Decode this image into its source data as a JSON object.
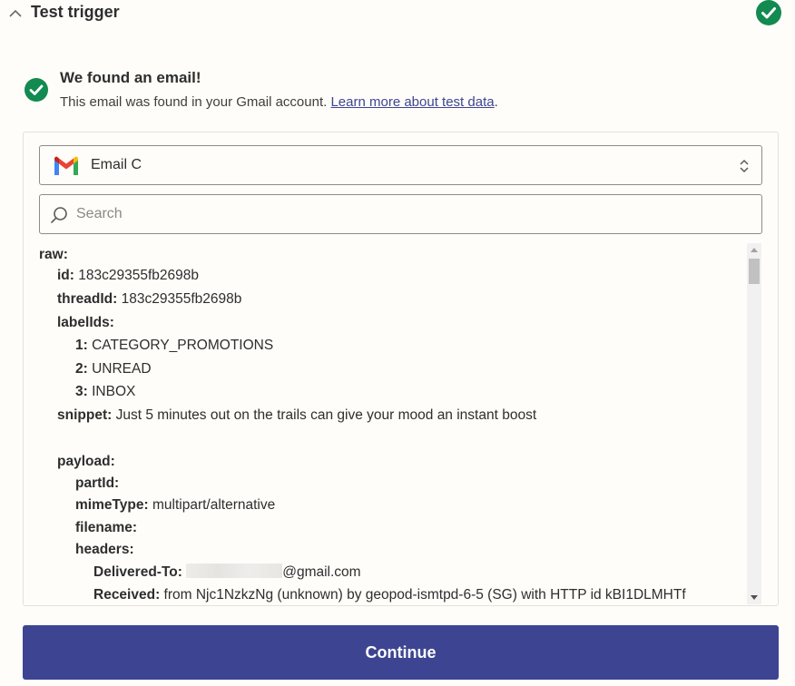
{
  "header": {
    "title": "Test trigger"
  },
  "found": {
    "title": "We found an email!",
    "desc_prefix": "This email was found in your Gmail account. ",
    "link": "Learn more about test data",
    "desc_suffix": "."
  },
  "select": {
    "value": "Email C"
  },
  "search": {
    "placeholder": "Search"
  },
  "tree": {
    "raw": "raw:",
    "id_key": "id:",
    "id_val": " 183c29355fb2698b",
    "thread_key": "threadId:",
    "thread_val": " 183c29355fb2698b",
    "labels_key": "labelIds:",
    "label1_key": "1:",
    "label1_val": " CATEGORY_PROMOTIONS",
    "label2_key": "2:",
    "label2_val": " UNREAD",
    "label3_key": "3:",
    "label3_val": " INBOX",
    "snippet_key": "snippet:",
    "snippet_val": " Just 5 minutes out on the trails can give your mood an instant boost",
    "payload_key": "payload:",
    "partid_key": "partId:",
    "mime_key": "mimeType:",
    "mime_val": " multipart/alternative",
    "filename_key": "filename:",
    "headers_key": "headers:",
    "delivered_key": "Delivered-To:",
    "delivered_val": "@gmail.com",
    "received_key": "Received:",
    "received_val": " from Njc1NzkzNg (unknown) by geopod-ismtpd-6-5 (SG) with HTTP id kBI1DLMHTf"
  },
  "actions": {
    "continue": "Continue"
  },
  "colors": {
    "accent": "#3d4592",
    "success": "#138a50"
  }
}
